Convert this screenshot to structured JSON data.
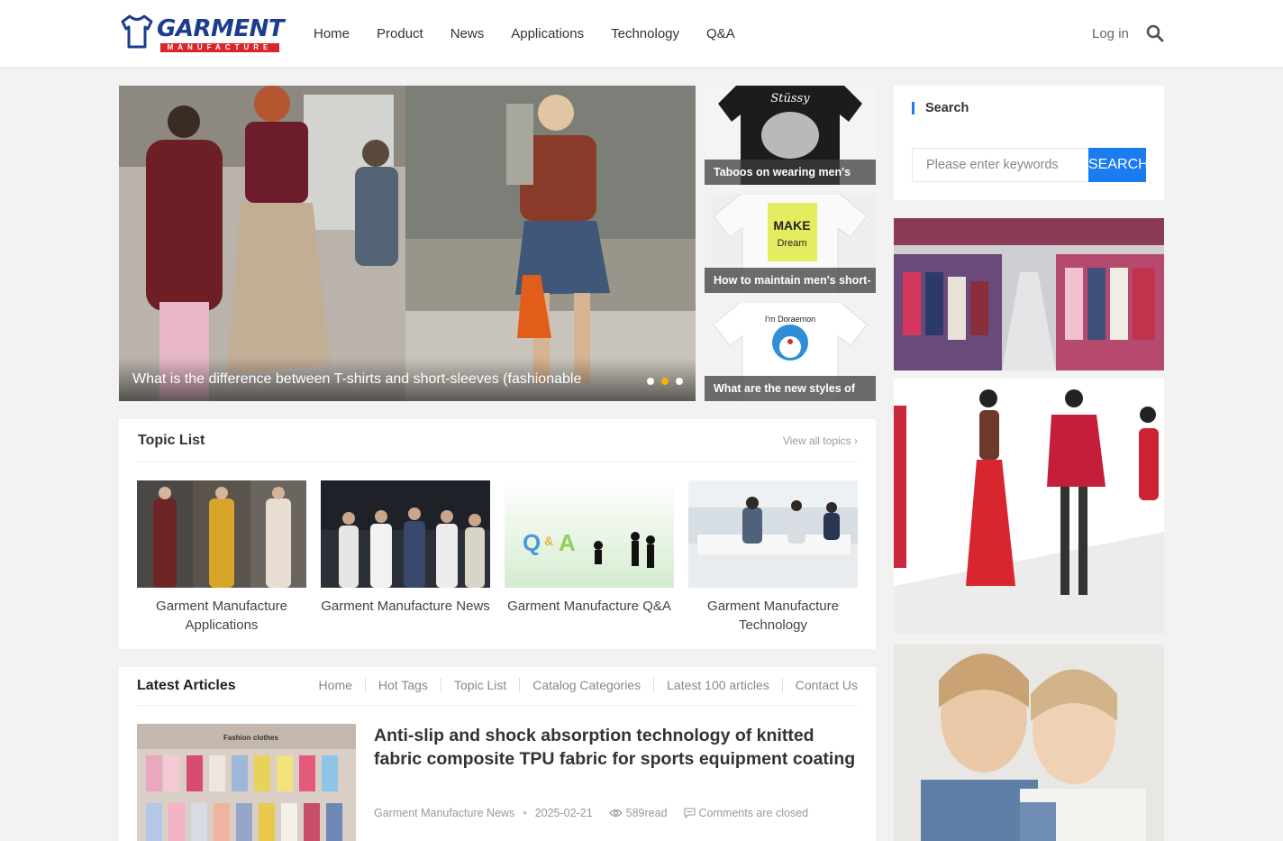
{
  "header": {
    "logo_text": "GARMENT",
    "logo_sub": "MANUFACTURE",
    "nav": [
      "Home",
      "Product",
      "News",
      "Applications",
      "Technology",
      "Q&A"
    ],
    "login": "Log in"
  },
  "slider": {
    "caption": "What is the difference between T-shirts and short-sleeves (fashionable",
    "active_dot": 2,
    "dot_count": 3
  },
  "thumbs": [
    {
      "caption": "Taboos on wearing men's"
    },
    {
      "caption": "How to maintain men's short-"
    },
    {
      "caption": "What are the new styles of"
    }
  ],
  "topic": {
    "title": "Topic List",
    "more": "View all topics ›",
    "items": [
      {
        "label": "Garment Manufacture Applications"
      },
      {
        "label": "Garment Manufacture News"
      },
      {
        "label": "Garment Manufacture Q&A"
      },
      {
        "label": "Garment Manufacture Technology"
      }
    ]
  },
  "latest": {
    "title": "Latest Articles",
    "links": [
      "Home",
      "Hot Tags",
      "Topic List",
      "Catalog Categories",
      "Latest 100 articles",
      "Contact Us"
    ],
    "article": {
      "title": "Anti-slip and shock absorption technology of knitted fabric composite TPU fabric for sports equipment coating",
      "category": "Garment Manufacture News",
      "date": "2025-02-21",
      "reads": "589read",
      "comments": "Comments are closed"
    }
  },
  "sidebar": {
    "search_title": "Search",
    "search_placeholder": "Please enter keywords",
    "search_button": "SEARCH"
  },
  "colors": {
    "accent": "#1a7cf0",
    "brand_blue": "#1a3d8f",
    "brand_red": "#d9262a",
    "active_dot": "#f5b400"
  }
}
